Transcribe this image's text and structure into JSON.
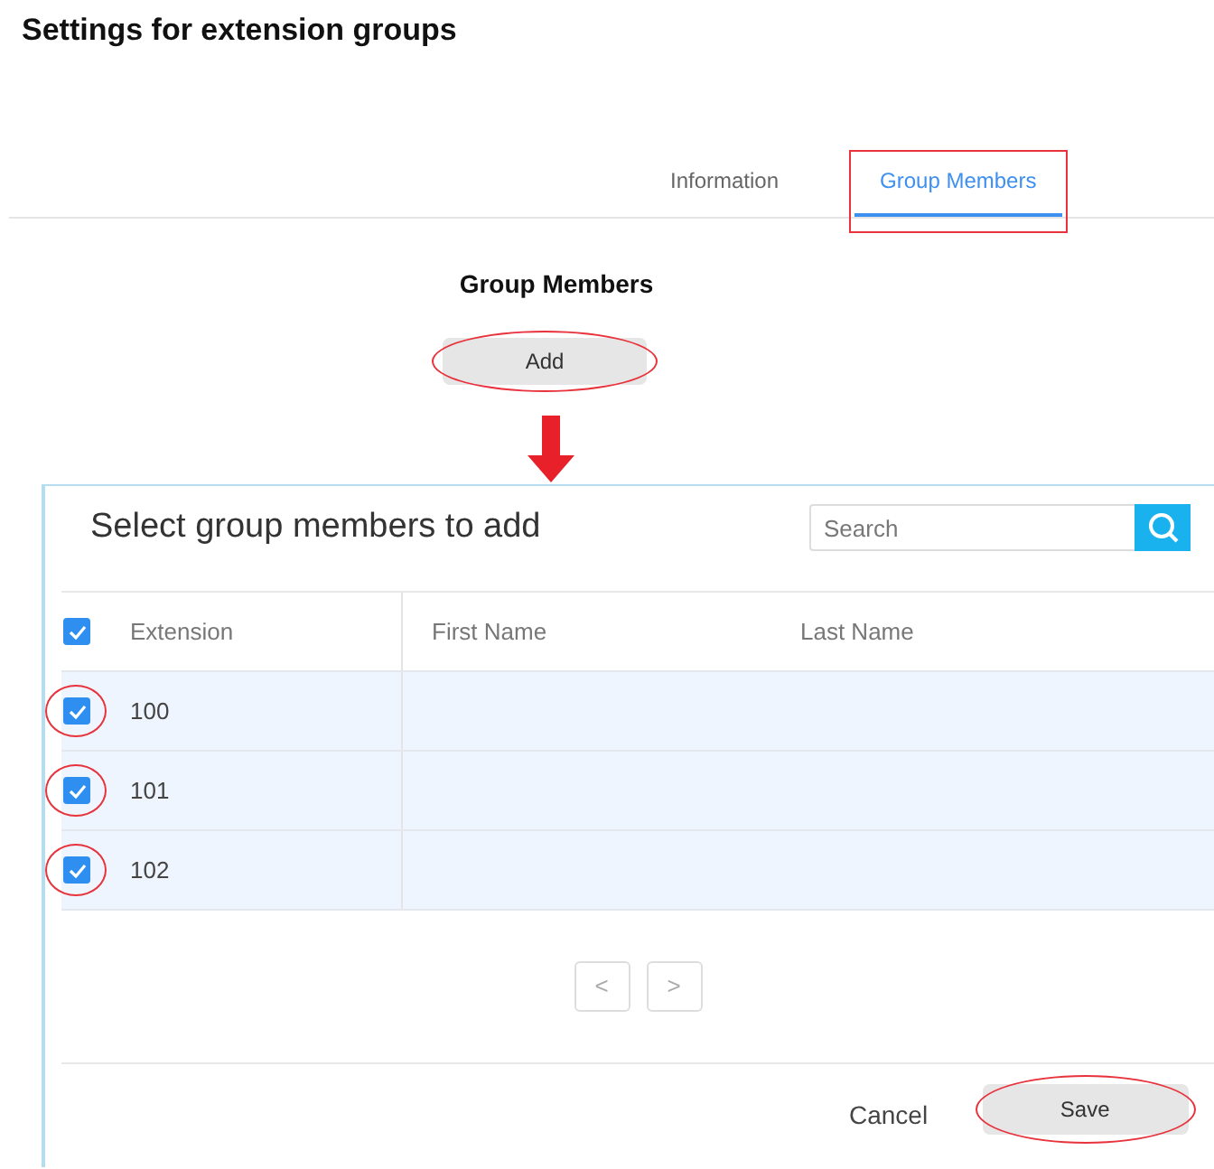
{
  "page": {
    "title": "Settings for extension groups"
  },
  "tabs": [
    {
      "label": "Information",
      "selected": false,
      "highlighted": false
    },
    {
      "label": "Group Members",
      "selected": true,
      "highlighted": true
    }
  ],
  "section": {
    "heading": "Group Members",
    "add_button": {
      "label": "Add",
      "highlighted": true
    }
  },
  "dialog": {
    "title": "Select group members to add",
    "search": {
      "placeholder": "Search"
    },
    "select_all_checked": true,
    "columns": [
      "Extension",
      "First Name",
      "Last Name"
    ],
    "rows": [
      {
        "extension": "100",
        "checked": true,
        "highlighted": true
      },
      {
        "extension": "101",
        "checked": true,
        "highlighted": true
      },
      {
        "extension": "102",
        "checked": true,
        "highlighted": true
      }
    ],
    "pagination": [
      "<",
      ">"
    ],
    "buttons": [
      {
        "label": "Cancel",
        "kind": "link",
        "highlighted": false
      },
      {
        "label": "Save",
        "kind": "default",
        "highlighted": true
      }
    ]
  }
}
